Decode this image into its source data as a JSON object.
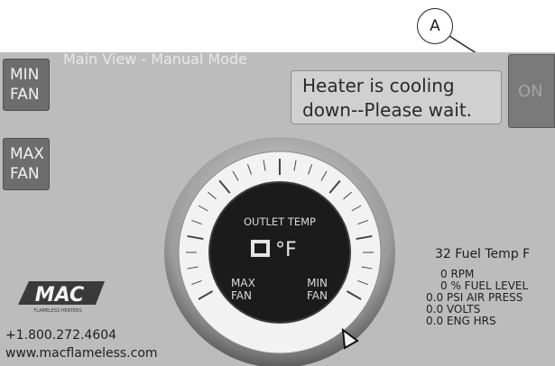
{
  "callout": {
    "label": "A"
  },
  "screen": {
    "mode_title": "Main View - Manual Mode",
    "buttons": {
      "min_fan": [
        "MIN",
        "FAN"
      ],
      "max_fan": [
        "MAX",
        "FAN"
      ],
      "on": "ON"
    },
    "status_message": [
      "Heater is cooling",
      "down--Please wait."
    ],
    "gauge": {
      "title": "OUTLET TEMP",
      "unit": "°F",
      "left_label": [
        "MAX",
        "FAN"
      ],
      "right_label": [
        "MIN",
        "FAN"
      ]
    },
    "brand": {
      "logo_text": "MAC",
      "logo_subtext": "FLAMELESS HEATERS",
      "phone": "+1.800.272.4604",
      "website": "www.macflameless.com"
    },
    "readouts": {
      "fuel_temp": {
        "value": "32",
        "label": "Fuel Temp F"
      },
      "rpm": {
        "value": "0",
        "label": "RPM"
      },
      "fuel_level": {
        "value": "0",
        "label": "% FUEL LEVEL"
      },
      "air_press": {
        "value": "0.0",
        "label": "PSI AIR PRESS"
      },
      "volts": {
        "value": "0.0",
        "label": "VOLTS"
      },
      "eng_hrs": {
        "value": "0.0",
        "label": "ENG HRS"
      }
    }
  }
}
